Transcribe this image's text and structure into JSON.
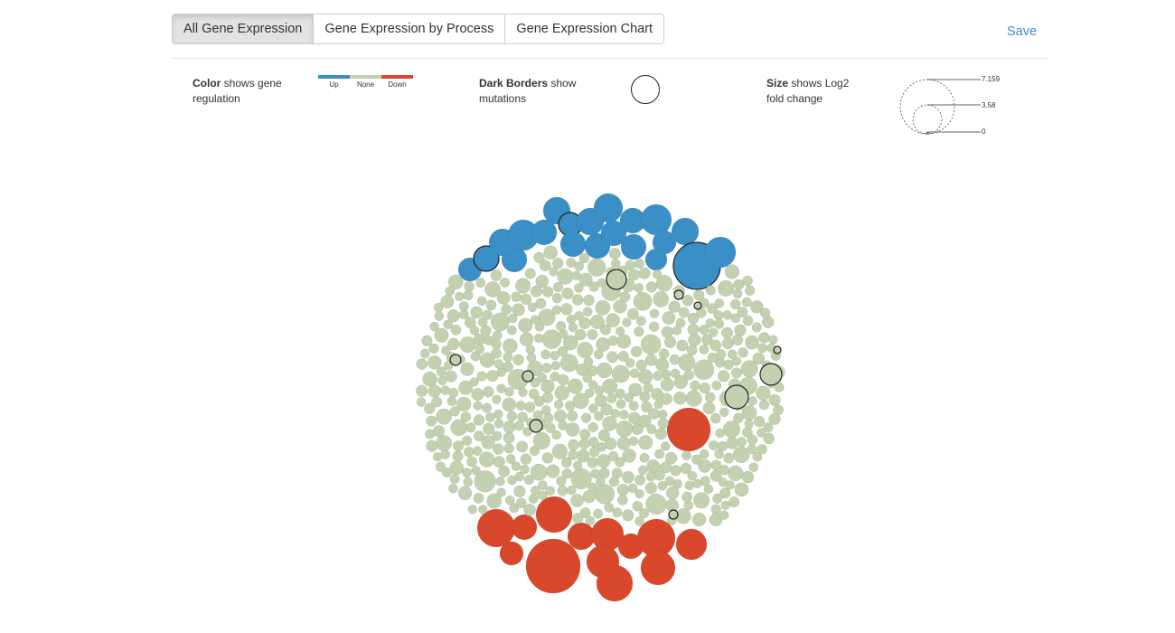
{
  "tabs": [
    {
      "label": "All Gene Expression",
      "active": true
    },
    {
      "label": "Gene Expression by Process",
      "active": false
    },
    {
      "label": "Gene Expression Chart",
      "active": false
    }
  ],
  "toolbar": {
    "save_label": "Save"
  },
  "legend": {
    "color": {
      "bold": "Color",
      "rest": " shows gene regulation",
      "labels": [
        "Up",
        "None",
        "Down"
      ],
      "colors": [
        "#3a8fc6",
        "#c2d1b0",
        "#d9482b"
      ]
    },
    "border": {
      "bold": "Dark Borders",
      "rest": " show mutations"
    },
    "size": {
      "bold": "Size",
      "rest": " shows Log2 fold change",
      "ticks": [
        "7.159",
        "3.58",
        "0"
      ]
    }
  },
  "colors": {
    "up": "#3a8fc6",
    "none": "#c2d1b0",
    "down": "#d9482b",
    "mutation_border": "#222222",
    "accent": "#428bca"
  }
}
